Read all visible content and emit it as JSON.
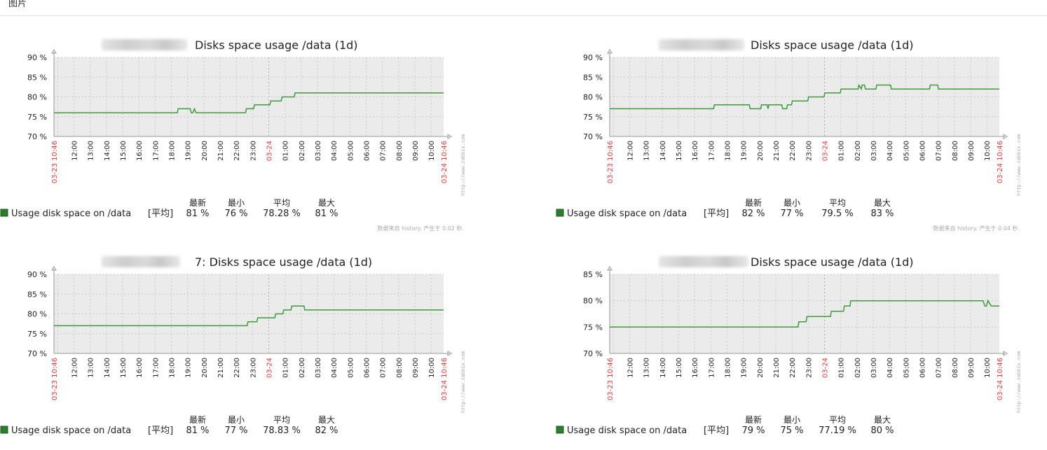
{
  "header": {
    "label": "图片"
  },
  "charts": [
    {
      "title": "Disks space usage /data (1d)",
      "title_prefix": "",
      "ytick_labels": [
        "90 %",
        "85 %",
        "80 %",
        "75 %",
        "70 %"
      ],
      "xtick_labels": [
        "12:00",
        "13:00",
        "14:00",
        "15:00",
        "16:00",
        "17:00",
        "18:00",
        "19:00",
        "20:00",
        "21:00",
        "22:00",
        "23:00",
        "01:00",
        "02:00",
        "03:00",
        "04:00",
        "05:00",
        "06:00",
        "07:00",
        "08:00",
        "09:00",
        "10:00"
      ],
      "date_labels": {
        "start": "03-23 10:46",
        "mid": "03-24",
        "end": "03-24 10:46"
      },
      "watermark": "http://www.zabbix.com",
      "legend": {
        "headers": [
          "最新",
          "最小",
          "平均",
          "最大"
        ],
        "item_label": "Usage disk space on /data",
        "func": "[平均]",
        "values": [
          "81 %",
          "76 %",
          "78.28 %",
          "81 %"
        ]
      },
      "footer": "数据来自 history. 产生于 0.02 秒."
    },
    {
      "title": "Disks space usage /data (1d)",
      "title_prefix": "",
      "ytick_labels": [
        "90 %",
        "85 %",
        "80 %",
        "75 %",
        "70 %"
      ],
      "xtick_labels": [
        "12:00",
        "13:00",
        "14:00",
        "15:00",
        "16:00",
        "17:00",
        "18:00",
        "19:00",
        "20:00",
        "21:00",
        "22:00",
        "23:00",
        "01:00",
        "02:00",
        "03:00",
        "04:00",
        "05:00",
        "06:00",
        "07:00",
        "08:00",
        "09:00",
        "10:00"
      ],
      "date_labels": {
        "start": "03-23 10:46",
        "mid": "03-24",
        "end": "03-24 10:46"
      },
      "watermark": "http://www.zabbix.com",
      "legend": {
        "headers": [
          "最新",
          "最小",
          "平均",
          "最大"
        ],
        "item_label": "Usage disk space on /data",
        "func": "[平均]",
        "values": [
          "82 %",
          "77 %",
          "79.5 %",
          "83 %"
        ]
      },
      "footer": "数据来自 history. 产生于 0.04 秒."
    },
    {
      "title": "7: Disks space usage /data (1d)",
      "title_prefix": "",
      "ytick_labels": [
        "90 %",
        "85 %",
        "80 %",
        "75 %",
        "70 %"
      ],
      "xtick_labels": [
        "12:00",
        "13:00",
        "14:00",
        "15:00",
        "16:00",
        "17:00",
        "18:00",
        "19:00",
        "20:00",
        "21:00",
        "22:00",
        "23:00",
        "01:00",
        "02:00",
        "03:00",
        "04:00",
        "05:00",
        "06:00",
        "07:00",
        "08:00",
        "09:00",
        "10:00"
      ],
      "date_labels": {
        "start": "03-23 10:46",
        "mid": "03-24",
        "end": "03-24 10:46"
      },
      "watermark": "http://www.zabbix.com",
      "legend": {
        "headers": [
          "最新",
          "最小",
          "平均",
          "最大"
        ],
        "item_label": "Usage disk space on /data",
        "func": "[平均]",
        "values": [
          "81 %",
          "77 %",
          "78.83 %",
          "82 %"
        ]
      },
      "footer": ""
    },
    {
      "title": "Disks space usage /data (1d)",
      "title_prefix": "",
      "ytick_labels": [
        "85 %",
        "80 %",
        "75 %",
        "70 %"
      ],
      "xtick_labels": [
        "12:00",
        "13:00",
        "14:00",
        "15:00",
        "16:00",
        "17:00",
        "18:00",
        "19:00",
        "20:00",
        "21:00",
        "22:00",
        "23:00",
        "01:00",
        "02:00",
        "03:00",
        "04:00",
        "05:00",
        "06:00",
        "07:00",
        "08:00",
        "09:00",
        "10:00"
      ],
      "date_labels": {
        "start": "03-23 10:46",
        "mid": "03-24",
        "end": "03-24 10:46"
      },
      "watermark": "http://www.zabbix.com",
      "legend": {
        "headers": [
          "最新",
          "最小",
          "平均",
          "最大"
        ],
        "item_label": "Usage disk space on /data",
        "func": "[平均]",
        "values": [
          "79 %",
          "75 %",
          "77.19 %",
          "80 %"
        ]
      },
      "footer": ""
    }
  ],
  "colors": {
    "line": "#3d9a3d",
    "plot_bg": "#ebebeb",
    "grid": "#c8c8c8",
    "date_red": "#e03c3c",
    "legend_swatch": "#2e7d2e"
  },
  "chart_data": [
    {
      "type": "line",
      "title": "Disks space usage /data (1d)",
      "xlabel": "",
      "ylabel": "",
      "ylim": [
        70,
        90
      ],
      "xlim": [
        0,
        24
      ],
      "grid": true,
      "legend": "bottom",
      "series": [
        {
          "name": "Usage disk space on /data",
          "x": [
            0,
            7.6,
            7.65,
            8.4,
            8.45,
            8.55,
            8.65,
            8.75,
            8.85,
            11.8,
            11.85,
            12.3,
            12.35,
            13.3,
            13.35,
            14.0,
            14.05,
            14.8,
            14.85,
            15.8,
            15.85,
            24
          ],
          "y": [
            76,
            76,
            77,
            77,
            76,
            76,
            77,
            76,
            76,
            76,
            77,
            77,
            78,
            78,
            79,
            79,
            80,
            80,
            81,
            81,
            81,
            81
          ]
        }
      ]
    },
    {
      "type": "line",
      "title": "Disks space usage /data (1d)",
      "xlabel": "",
      "ylabel": "",
      "ylim": [
        70,
        90
      ],
      "xlim": [
        0,
        24
      ],
      "grid": true,
      "legend": "bottom",
      "series": [
        {
          "name": "Usage disk space on /data",
          "x": [
            0,
            6.4,
            6.45,
            8.6,
            8.65,
            9.3,
            9.35,
            9.7,
            9.75,
            9.8,
            9.85,
            10.6,
            10.65,
            10.9,
            10.95,
            11.2,
            11.25,
            12.2,
            12.25,
            13.2,
            13.25,
            14.2,
            14.25,
            15.3,
            15.35,
            15.5,
            15.55,
            15.7,
            15.75,
            16.4,
            16.45,
            17.3,
            17.35,
            18.0,
            18.05,
            19.7,
            19.75,
            20.2,
            20.25,
            24
          ],
          "y": [
            77,
            77,
            78,
            78,
            77,
            77,
            78,
            78,
            77,
            78,
            78,
            78,
            77,
            77,
            78,
            78,
            79,
            79,
            80,
            80,
            81,
            81,
            82,
            82,
            83,
            82,
            83,
            83,
            82,
            82,
            83,
            83,
            82,
            82,
            82,
            82,
            83,
            83,
            82,
            82
          ]
        }
      ]
    },
    {
      "type": "line",
      "title": "7: Disks space usage /data (1d)",
      "xlabel": "",
      "ylabel": "",
      "ylim": [
        70,
        90
      ],
      "xlim": [
        0,
        24
      ],
      "grid": true,
      "legend": "bottom",
      "series": [
        {
          "name": "Usage disk space on /data",
          "x": [
            0,
            11.9,
            11.95,
            12.5,
            12.55,
            13.6,
            13.65,
            14.1,
            14.15,
            14.6,
            14.65,
            15.0,
            15.05,
            15.4,
            15.45,
            24
          ],
          "y": [
            77,
            77,
            78,
            78,
            79,
            79,
            80,
            80,
            81,
            81,
            82,
            82,
            82,
            82,
            81,
            81
          ]
        }
      ]
    },
    {
      "type": "line",
      "title": "Disks space usage /data (1d)",
      "xlabel": "",
      "ylabel": "",
      "ylim": [
        70,
        85
      ],
      "xlim": [
        0,
        24
      ],
      "grid": true,
      "legend": "bottom",
      "series": [
        {
          "name": "Usage disk space on /data",
          "x": [
            0,
            11.6,
            11.65,
            12.1,
            12.15,
            13.6,
            13.65,
            14.4,
            14.45,
            14.8,
            14.85,
            23.0,
            23.1,
            23.2,
            23.3,
            23.5,
            24
          ],
          "y": [
            75,
            75,
            76,
            76,
            77,
            77,
            78,
            78,
            79,
            79,
            80,
            80,
            79,
            79,
            80,
            79,
            79
          ]
        }
      ]
    }
  ]
}
